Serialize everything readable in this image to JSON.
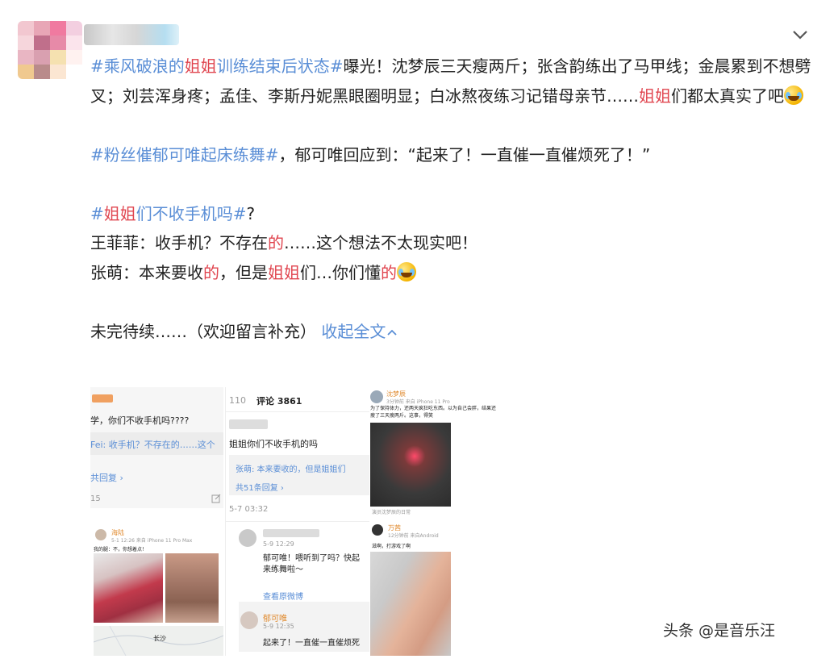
{
  "post": {
    "paragraph1": {
      "topic1": "#乘风破浪的",
      "topic1_hl": "姐姐",
      "topic1_rest": "训练结束后状态#",
      "text1": "曝光！沈梦辰三天瘦两斤；张含韵练出了马甲线；金晨累到不想劈叉；刘芸浑身疼；孟佳、李斯丹妮黑眼圈明显；白冰熬夜练习记错母亲节……",
      "hl": "姐姐",
      "text2": "们都太真实了吧"
    },
    "paragraph2": {
      "topic": "#粉丝催郁可唯起床练舞#",
      "text": "，郁可唯回应到：“起来了！一直催一直催烦死了！”"
    },
    "paragraph3": {
      "topic_pre": "#",
      "topic_hl": "姐姐",
      "topic_rest": "们不收手机吗#",
      "topic_q": "?"
    },
    "line_wang": {
      "a": "王菲菲：收手机？不存在",
      "hl": "的",
      "b": "……这个想法不太现实吧！"
    },
    "line_zhang": {
      "a": "张萌：本来要收",
      "hl1": "的",
      "b": "，但是",
      "hl2": "姐姐",
      "c": "们…你们懂",
      "hl3": "的"
    },
    "ending": {
      "text": "未完待续……（欢迎留言补充）",
      "collapse": "收起全文"
    }
  },
  "images": {
    "img1": {
      "question": "学，你们不收手机吗????",
      "reply": "Fei: 收手机？不存在的……这个",
      "replies": "共回复 ›",
      "count": "15"
    },
    "img2": {
      "tab_num": "110",
      "comments_label": "评论 3861",
      "comment": "姐姐你们不收手机的吗",
      "reply": "张萌: 本来要收的，但是姐姐们",
      "reply_count": "共51条回复 ›",
      "time1": "5-7 03:32",
      "c2_time": "5-9 12:29",
      "c2_text": "郁可唯！喂听到了吗？快起来练舞啦～",
      "view_orig": "查看原微博",
      "c3_name": "郁可唯",
      "c3_time": "5-9 12:35",
      "c3_text": "起来了！一直催一直催烦死"
    },
    "img3": {
      "name": "沈梦辰",
      "meta": "3分钟前  来自 iPhone 11 Pro",
      "text": "为了保持体力，还两天疯狂吃东西。以为自己会胖，结果还瘦了三天瘦两斤。这事，得笑",
      "caption": "演员沈梦辰的日常"
    },
    "img4": {
      "name": "海陆",
      "meta": "5-1 12:26  来自 iPhone 11 Pro Max",
      "text": "我的腿：不，你想着点！",
      "location": "长沙"
    },
    "img5": {
      "name": "万茜",
      "meta": "12分钟前  来自Android",
      "text": "滋啊，打游戏了啊"
    }
  },
  "watermark": "头条 @是音乐汪",
  "colors": {
    "topic_blue": "#5a8ed6",
    "highlight_red": "#e0454f"
  }
}
